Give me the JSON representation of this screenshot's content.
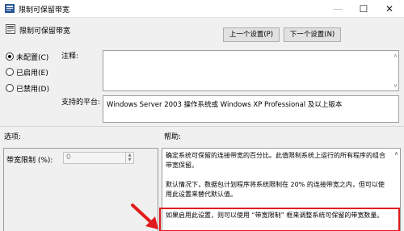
{
  "window": {
    "title": "限制可保留带宽",
    "minimize_glyph": "—",
    "maximize_glyph": "☐",
    "close_glyph": "✕"
  },
  "header": {
    "policy_name": "限制可保留带宽",
    "prev_button": "上一个设置(P)",
    "next_button": "下一个设置(N)"
  },
  "state": {
    "options": [
      {
        "label": "未配置(C)",
        "selected": true
      },
      {
        "label": "已启用(E)",
        "selected": false
      },
      {
        "label": "已禁用(D)",
        "selected": false
      }
    ]
  },
  "comment": {
    "label": "注释:",
    "value": ""
  },
  "platform": {
    "label": "支持的平台:",
    "value": "Windows Server 2003 操作系统或 Windows XP Professional 及以上版本"
  },
  "options_section": {
    "label": "选项:",
    "bandwidth_label": "带宽限制 (%):",
    "bandwidth_value": "0"
  },
  "help_section": {
    "label": "帮助:",
    "paragraphs": [
      "确定系统可保留的连接带宽的百分比。此值限制系统上运行的所有程序的组合带宽保留。",
      "默认情况下，数据包计划程序将系统限制在 20% 的连接带宽之内，但可以使用此设置来替代默认值。",
      "如果启用此设置，则可以使用 “带宽限制” 框来调整系统可保留的带宽数量。"
    ]
  },
  "colors": {
    "annotation": "#e11b1b",
    "window_bg": "#f0f0f0"
  },
  "icons": [
    "policy-window-icon",
    "policy-setting-icon",
    "annotation-arrow-icon"
  ]
}
